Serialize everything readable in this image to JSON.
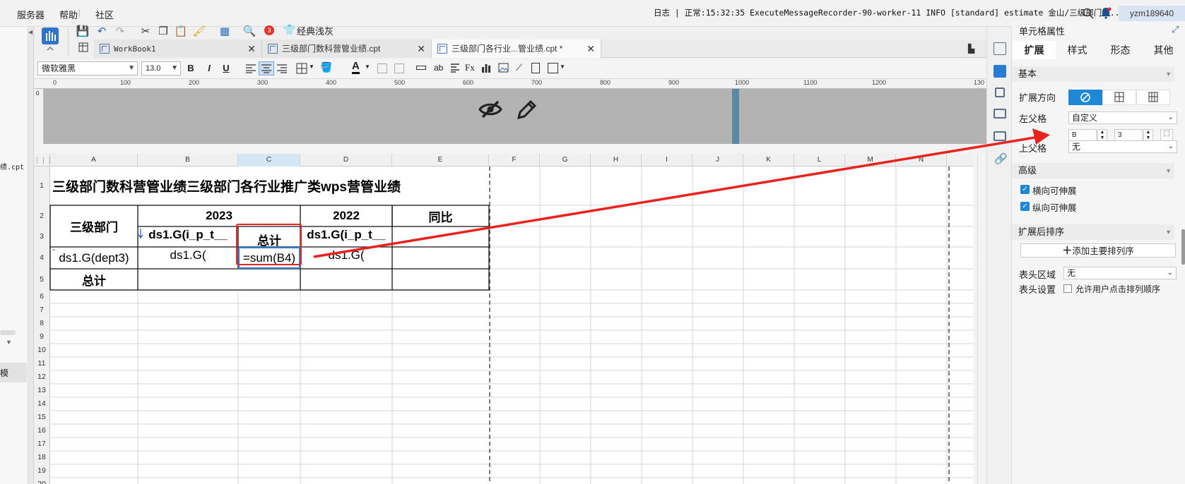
{
  "menu": {
    "items": [
      "服务器",
      "帮助",
      "社区"
    ]
  },
  "logbar": {
    "text": "日志 | 正常:15:32:35 ExecuteMessageRecorder-90-worker-11 INFO [standard] estimate 金山/三级部门各..."
  },
  "user": {
    "name": "yzm189640"
  },
  "toolbar": {
    "classic_label": "经典浅灰",
    "badge_count": "3"
  },
  "tabs": [
    {
      "label": "WorkBook1",
      "active": false
    },
    {
      "label": "三级部门数科营管业绩.cpt",
      "active": false
    },
    {
      "label": "三级部门各行业...管业绩.cpt *",
      "active": true
    }
  ],
  "format": {
    "font_name": "微软雅黑",
    "font_size": "13.0",
    "bold": "B",
    "italic": "I",
    "underline": "U",
    "text_color_glyph": "A",
    "formula_label": "Fx"
  },
  "left_panel": {
    "file_label": "绩.cpt",
    "side_label": "模"
  },
  "ruler": {
    "v_zero": "0",
    "ticks": [
      "0",
      "100",
      "200",
      "300",
      "400",
      "500",
      "600",
      "700",
      "800",
      "900",
      "1000",
      "1100",
      "1200",
      "130"
    ]
  },
  "sheet": {
    "columns": [
      "A",
      "B",
      "C",
      "D",
      "E",
      "F",
      "G",
      "H",
      "I",
      "J",
      "K",
      "L",
      "M",
      "N"
    ],
    "active_column": "C",
    "rows": [
      "1",
      "2",
      "3",
      "4",
      "5",
      "6",
      "7",
      "8",
      "9",
      "10",
      "11",
      "12",
      "13",
      "14",
      "15",
      "16",
      "17",
      "18",
      "19",
      "20"
    ],
    "cells": {
      "title": "三级部门数科营管业绩三级部门各行业推广类wps营管业绩",
      "dept_header": "三级部门",
      "year_2023": "2023",
      "year_2022": "2022",
      "yoy": "同比",
      "b3": "ds1.G(i_p_t__",
      "c3": "总计",
      "d3": "ds1.G(i_p_t__",
      "a4": "ds1.G(dept3)",
      "b4": "ds1.G(",
      "c4": "=sum(B4)",
      "d4": "ds1.G(",
      "a5": "总计"
    }
  },
  "props": {
    "title": "单元格属性",
    "tabs": [
      "扩展",
      "样式",
      "形态",
      "其他"
    ],
    "active_tab": "扩展",
    "section_basic": "基本",
    "expand_direction_label": "扩展方向",
    "left_parent_label": "左父格",
    "left_parent_value": "自定义",
    "coord_col": "B",
    "coord_row": "3",
    "upper_parent_label": "上父格",
    "upper_parent_value": "无",
    "section_advanced": "高级",
    "horizontal_expand": "横向可伸展",
    "vertical_expand": "纵向可伸展",
    "section_sort": "扩展后排序",
    "add_sort_label": "添加主要排列序",
    "header_area_label": "表头区域",
    "header_area_value": "无",
    "header_setting_label": "表头设置",
    "allow_sort_label": "允许用户点击排列顺序"
  },
  "colors": {
    "accent": "#1e88d6",
    "annotation_red": "#e8231e",
    "selected_cell_blue": "#2b7bd6"
  }
}
